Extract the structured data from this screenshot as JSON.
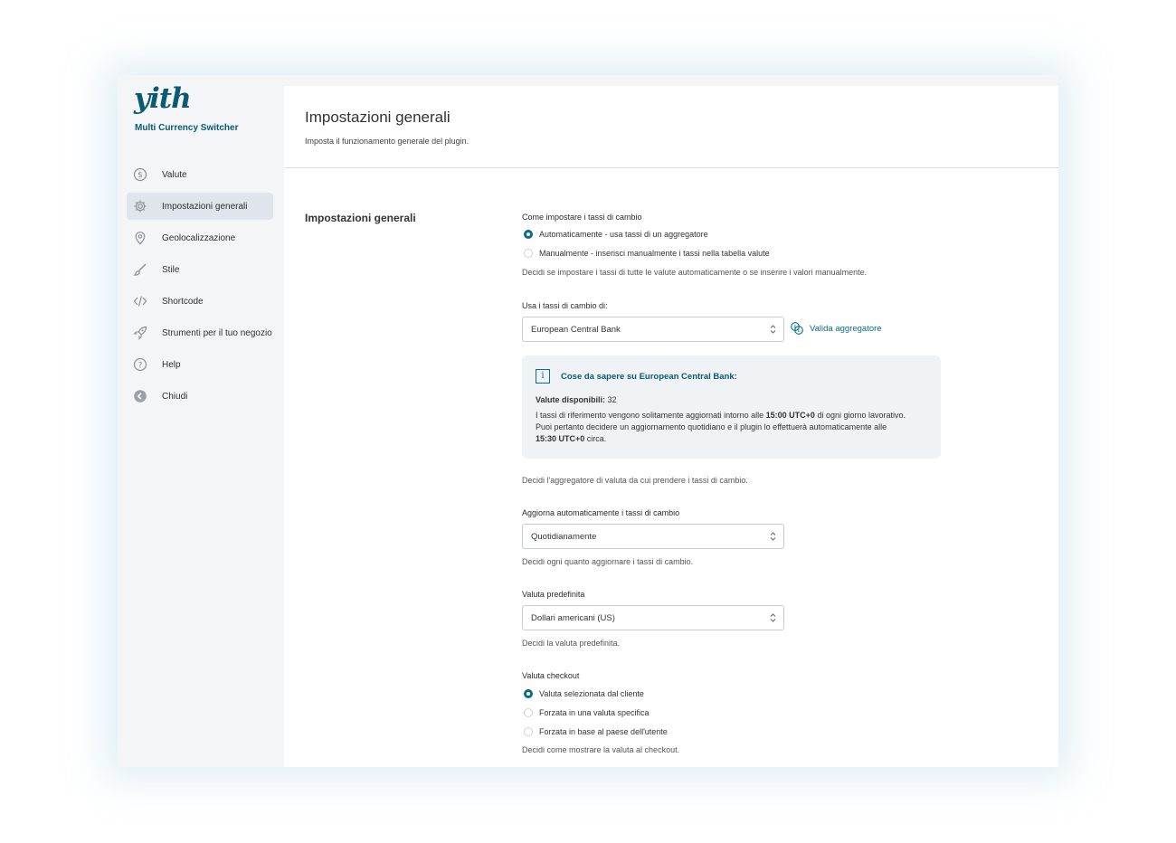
{
  "brand": {
    "logo_text": "yith",
    "app_name": "Multi Currency Switcher"
  },
  "sidebar": {
    "items": [
      {
        "label": "Valute",
        "icon": "dollar-circle-icon"
      },
      {
        "label": "Impostazioni generali",
        "icon": "gear-icon",
        "active": true
      },
      {
        "label": "Geolocalizzazione",
        "icon": "map-pin-icon"
      },
      {
        "label": "Stile",
        "icon": "brush-icon"
      },
      {
        "label": "Shortcode",
        "icon": "code-icon"
      },
      {
        "label": "Strumenti per il tuo negozio",
        "icon": "rocket-icon"
      },
      {
        "label": "Help",
        "icon": "help-circle-icon"
      },
      {
        "label": "Chiudi",
        "icon": "back-arrow-icon"
      }
    ]
  },
  "header": {
    "title": "Impostazioni generali",
    "subtitle": "Imposta il funzionamento generale del plugin."
  },
  "section": {
    "label": "Impostazioni generali"
  },
  "rates_mode": {
    "label": "Come impostare i tassi di cambio",
    "options": [
      {
        "label": "Automaticamente - usa tassi di un aggregatore",
        "checked": true
      },
      {
        "label": "Manualmente - inserisci manualmente i tassi nella tabella valute",
        "checked": false
      }
    ],
    "description": "Decidi se impostare i tassi di tutte le valute automaticamente o se inserire i valori manualmente."
  },
  "aggregator": {
    "label": "Usa i tassi di cambio di:",
    "value": "European Central Bank",
    "validate_label": "Valida aggregatore",
    "description": "Decidi l'aggregatore di valuta da cui prendere i tassi di cambio.",
    "info": {
      "title": "Cose da sapere su European Central Bank:",
      "available_label": "Valute disponibili:",
      "available_count": "32",
      "line1_a": "I tassi di riferimento vengono solitamente aggiornati intorno alle ",
      "line1_time": "15:00 UTC+0",
      "line1_b": " di ogni giorno lavorativo.",
      "line2": "Puoi pertanto decidere un aggiornamento quotidiano e il plugin lo effettuerà automaticamente alle",
      "line3_time": "15:30 UTC+0",
      "line3_b": " circa."
    }
  },
  "auto_update": {
    "label": "Aggiorna automaticamente i tassi di cambio",
    "value": "Quotidianamente",
    "description": "Decidi ogni quanto aggiornare i tassi di cambio."
  },
  "default_currency": {
    "label": "Valuta predefinita",
    "value": "Dollari americani (US)",
    "description": "Decidi la valuta predefinita."
  },
  "checkout_currency": {
    "label": "Valuta checkout",
    "options": [
      {
        "label": "Valuta selezionata dal cliente",
        "checked": true
      },
      {
        "label": "Forzata in una valuta specifica",
        "checked": false
      },
      {
        "label": "Forzata in base al paese dell'utente",
        "checked": false
      }
    ],
    "description": "Decidi come mostrare la valuta al checkout."
  },
  "colors": {
    "accent": "#0a6b8a",
    "brand": "#0a5a73",
    "sidebar_bg": "#f3f5f7",
    "active_bg": "#dfe5eb"
  }
}
